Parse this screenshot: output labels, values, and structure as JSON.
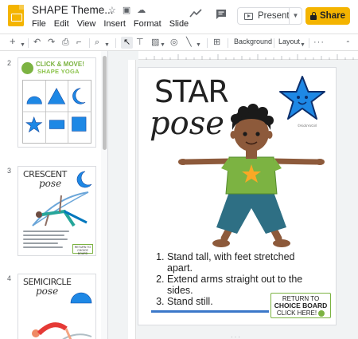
{
  "header": {
    "doc_title": "SHAPE Theme...",
    "menu": [
      "File",
      "Edit",
      "View",
      "Insert",
      "Format",
      "Slide"
    ],
    "present_label": "Present",
    "share_label": "Share"
  },
  "toolbar": {
    "background_label": "Background",
    "layout_label": "Layout"
  },
  "filmstrip": {
    "slides": [
      {
        "number": "2",
        "title_line1": "CLICK & MOVE!",
        "title_line2": "SHAPE YOGA"
      },
      {
        "number": "3",
        "title": "CRESCENT",
        "subtitle": "pose",
        "button_text": "RETURN TO CHOICE BOARD"
      },
      {
        "number": "4",
        "title": "SEMICIRCLE",
        "subtitle": "pose"
      }
    ]
  },
  "slide": {
    "title_word1": "STAR",
    "title_word2": "pose",
    "credit": "©KidsYoGirl",
    "steps": [
      "Stand tall, with feet stretched apart.",
      "Extend arms straight out to the sides.",
      "Stand still."
    ],
    "button_line1": "RETURN TO",
    "button_line2": "CHOICE BOARD",
    "button_line3": "CLICK HERE!"
  },
  "colors": {
    "share": "#f4b400",
    "star_blue": "#1e88e5",
    "shirt_green": "#7cb342",
    "pants_teal": "#2e6f84",
    "accent_line": "#3b78c9"
  }
}
